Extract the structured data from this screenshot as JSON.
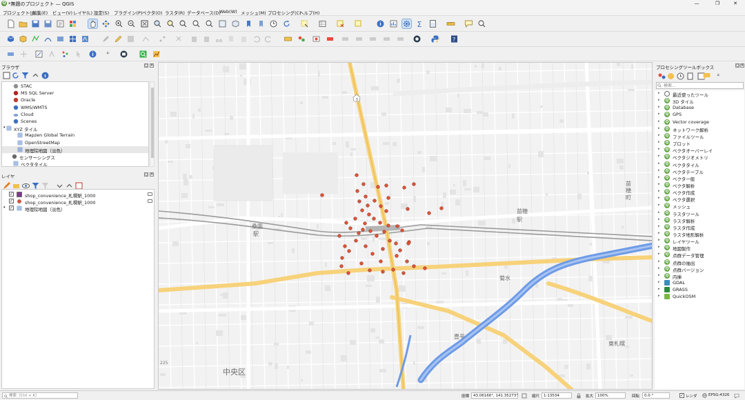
{
  "window": {
    "title": "*無題のプロジェクト — QGIS",
    "minimize": "—",
    "maximize": "❐",
    "close": "✕"
  },
  "menu": [
    "プロジェクト(J)",
    "編集(E)",
    "ビュー(V)",
    "レイヤ(L)",
    "設定(S)",
    "プラグイン(P)",
    "ベクタ(O)",
    "ラスタ(R)",
    "データベース(D)",
    "Web(W)",
    "メッシュ(M)",
    "プロセシング(C)",
    "ヘルプ(H)"
  ],
  "browser": {
    "title": "ブラウザ",
    "items": [
      {
        "label": "STAC",
        "icon": "stac-icon"
      },
      {
        "label": "MS SQL Server",
        "icon": "mssql-icon"
      },
      {
        "label": "Oracle",
        "icon": "oracle-icon"
      },
      {
        "label": "WMS/WMTS",
        "icon": "globe-icon"
      },
      {
        "label": "Cloud",
        "icon": "cloud-icon"
      },
      {
        "label": "Scenes",
        "icon": "scenes-icon"
      },
      {
        "label": "XYZ タイル",
        "icon": "grid-icon"
      },
      {
        "label": "Mapzen Global Terrain",
        "icon": "grid-icon"
      },
      {
        "label": "OpenStreetMap",
        "icon": "grid-icon"
      },
      {
        "label": "地理院地図（淡色）",
        "icon": "grid-icon"
      },
      {
        "label": "センサーシングス",
        "icon": "sensor-icon"
      },
      {
        "label": "ベクタタイル",
        "icon": "grid-icon"
      }
    ]
  },
  "layers": {
    "title": "レイヤ",
    "items": [
      {
        "label": "shop_convenience_札幌駅_1000",
        "checked": "✓",
        "symbol": "polygon"
      },
      {
        "label": "shop_convenience_札幌駅_1000",
        "checked": "✓",
        "symbol": "point"
      },
      {
        "label": "地理院地図（淡色）",
        "checked": "✓",
        "symbol": "raster"
      }
    ]
  },
  "map": {
    "labels": {
      "ward": "中央区",
      "naebo1": "苗穂",
      "naebo1_b": "駅",
      "naebo2": "苗",
      "naebo2_b": "穂",
      "naebo2_c": "町",
      "kuwazono": "桑園",
      "kuwazono_b": "駅",
      "toyohira": "豊平",
      "kikusui": "菊水",
      "higashisapporo": "東札幌",
      "route5": "5",
      "route225": "225"
    },
    "colors": {
      "major_road": "#f7d27a",
      "river": "#6e9be6",
      "point": "#d9553a"
    }
  },
  "toolbox": {
    "title": "プロセシングツールボックス",
    "search_placeholder": "検索...",
    "items": [
      "最近使ったツール",
      "3D タイル",
      "Database",
      "GPS",
      "Vector coverage",
      "ネットワーク解析",
      "ファイルツール",
      "プロット",
      "ベクタオーバーレイ",
      "ベクタジオメトリ",
      "ベクタタイル",
      "ベクタテーブル",
      "ベクタ一般",
      "ベクタ解析",
      "ベクタ作成",
      "ベクタ選択",
      "メッシュ",
      "ラスタツール",
      "ラスタ解析",
      "ラスタ作成",
      "ラスタ地形解析",
      "レイヤツール",
      "地図製作",
      "点群データ管理",
      "点群の抽出",
      "点群バージョン",
      "内挿",
      "GDAL",
      "GRASS",
      "QuickOSM"
    ]
  },
  "status": {
    "search_placeholder": "検索（Ctrl + K）",
    "coord_label": "座標",
    "coord_value": "43.06166°, 141.35273°",
    "scale_label": "縮尺",
    "scale_value": "1:13534",
    "magnifier_label": "拡大",
    "magnifier_value": "100%",
    "rotation_label": "回転",
    "rotation_value": "0.0 °",
    "render_label": "レンダ",
    "crs": "EPSG:4326"
  }
}
